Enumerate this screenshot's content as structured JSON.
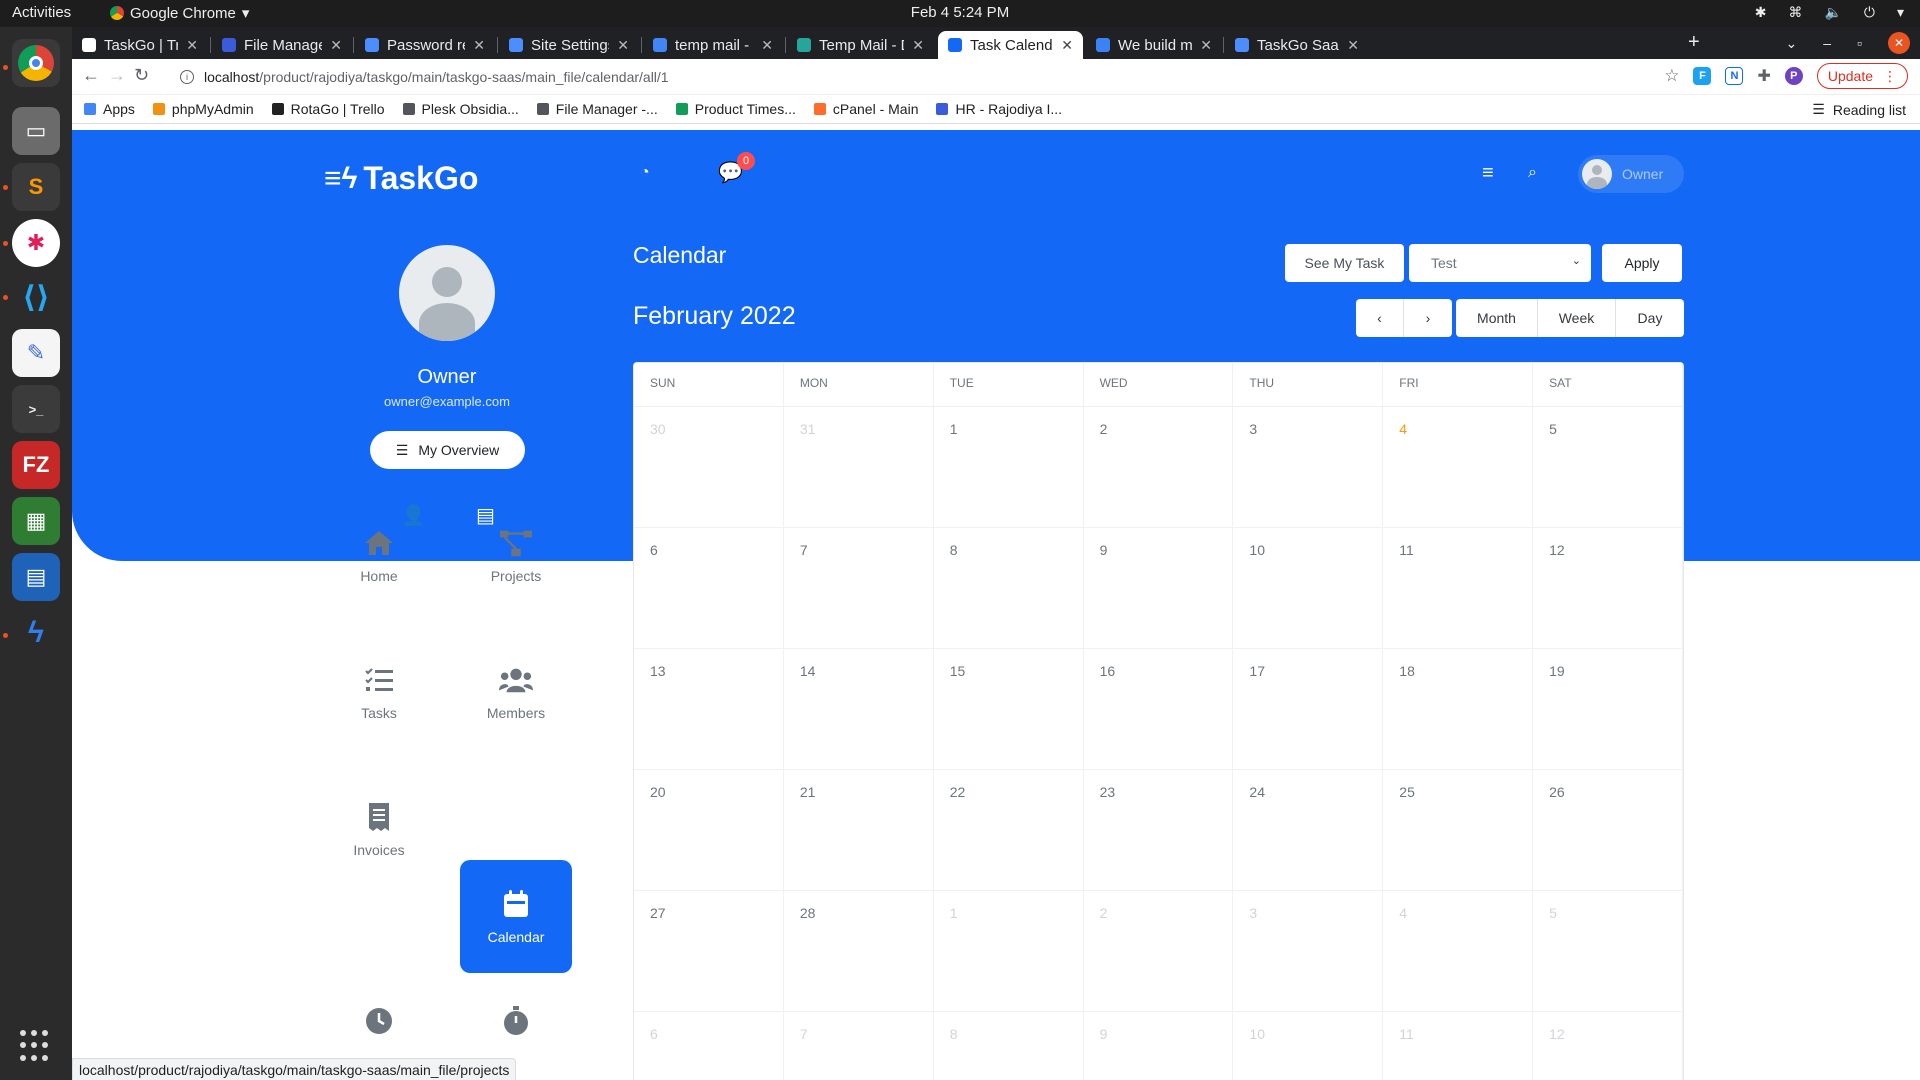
{
  "os": {
    "activities": "Activities",
    "app_name": "Google Chrome",
    "clock": "Feb 4  5:24 PM"
  },
  "browser": {
    "tabs": [
      {
        "title": "TaskGo | Trello",
        "active": false,
        "icon_color": "#ffffff"
      },
      {
        "title": "File Manager - Pl",
        "active": false,
        "icon_color": "#3b5bdb"
      },
      {
        "title": "Password reset -",
        "active": false,
        "icon_color": "#4c8dff"
      },
      {
        "title": "Site Settings - Ta",
        "active": false,
        "icon_color": "#4c8dff"
      },
      {
        "title": "temp mail - Goog",
        "active": false,
        "icon_color": "#4285f4"
      },
      {
        "title": "Temp Mail - Disp",
        "active": false,
        "icon_color": "#26a69a"
      },
      {
        "title": "Task Calendar - T",
        "active": true,
        "icon_color": "#1369f5"
      },
      {
        "title": "We build moder",
        "active": false,
        "icon_color": "#3b82f6"
      },
      {
        "title": "TaskGo SaaS - Zo",
        "active": false,
        "icon_color": "#4c8dff"
      }
    ],
    "url_host": "localhost",
    "url_path": "/product/rajodiya/taskgo/main/taskgo-saas/main_file/calendar/all/1",
    "update_label": "Update",
    "bookmarks": [
      {
        "label": "Apps",
        "color": "#4285f4"
      },
      {
        "label": "phpMyAdmin",
        "color": "#f29111"
      },
      {
        "label": "RotaGo | Trello",
        "color": "#222222"
      },
      {
        "label": "Plesk Obsidia...",
        "color": "#52565c"
      },
      {
        "label": "File Manager -...",
        "color": "#52565c"
      },
      {
        "label": "Product Times...",
        "color": "#0f9d58"
      },
      {
        "label": "cPanel - Main",
        "color": "#ff6c2c"
      },
      {
        "label": "HR - Rajodiya I...",
        "color": "#3b5bdb"
      }
    ],
    "reading_list": "Reading list",
    "status_url": "localhost/product/rajodiya/taskgo/main/taskgo-saas/main_file/projects"
  },
  "app": {
    "brand": "TaskGo",
    "chat_badge": "0",
    "user_chip": "Owner",
    "profile": {
      "name": "Owner",
      "email": "owner@example.com",
      "overview_label": "My Overview"
    },
    "nav": [
      {
        "label": "Home",
        "icon": "home-icon"
      },
      {
        "label": "Projects",
        "icon": "projects-icon"
      },
      {
        "label": "Tasks",
        "icon": "tasks-icon"
      },
      {
        "label": "Members",
        "icon": "members-icon"
      },
      {
        "label": "Invoices",
        "icon": "invoices-icon"
      },
      {
        "label": "Calendar",
        "icon": "calendar-icon",
        "active": true
      },
      {
        "label": "",
        "icon": "clock-icon"
      },
      {
        "label": "",
        "icon": "stopwatch-icon"
      }
    ]
  },
  "calendar": {
    "title": "Calendar",
    "see_my_task": "See My Task",
    "project_select": "Test",
    "apply": "Apply",
    "month_label": "February 2022",
    "views": {
      "month": "Month",
      "week": "Week",
      "day": "Day"
    },
    "weekdays": [
      "SUN",
      "MON",
      "TUE",
      "WED",
      "THU",
      "FRI",
      "SAT"
    ],
    "days": [
      {
        "n": "30",
        "muted": true
      },
      {
        "n": "31",
        "muted": true
      },
      {
        "n": "1"
      },
      {
        "n": "2"
      },
      {
        "n": "3"
      },
      {
        "n": "4",
        "today": true
      },
      {
        "n": "5"
      },
      {
        "n": "6"
      },
      {
        "n": "7"
      },
      {
        "n": "8"
      },
      {
        "n": "9"
      },
      {
        "n": "10"
      },
      {
        "n": "11"
      },
      {
        "n": "12"
      },
      {
        "n": "13"
      },
      {
        "n": "14"
      },
      {
        "n": "15"
      },
      {
        "n": "16"
      },
      {
        "n": "17"
      },
      {
        "n": "18"
      },
      {
        "n": "19"
      },
      {
        "n": "20"
      },
      {
        "n": "21"
      },
      {
        "n": "22"
      },
      {
        "n": "23"
      },
      {
        "n": "24"
      },
      {
        "n": "25"
      },
      {
        "n": "26"
      },
      {
        "n": "27"
      },
      {
        "n": "28"
      },
      {
        "n": "1",
        "muted": true
      },
      {
        "n": "2",
        "muted": true
      },
      {
        "n": "3",
        "muted": true
      },
      {
        "n": "4",
        "muted": true
      },
      {
        "n": "5",
        "muted": true
      },
      {
        "n": "6",
        "muted": true
      },
      {
        "n": "7",
        "muted": true
      },
      {
        "n": "8",
        "muted": true
      },
      {
        "n": "9",
        "muted": true
      },
      {
        "n": "10",
        "muted": true
      },
      {
        "n": "11",
        "muted": true
      },
      {
        "n": "12",
        "muted": true
      }
    ]
  },
  "colors": {
    "primary": "#1369f5",
    "today": "#f59b0b",
    "badge": "#ff4d4f"
  }
}
